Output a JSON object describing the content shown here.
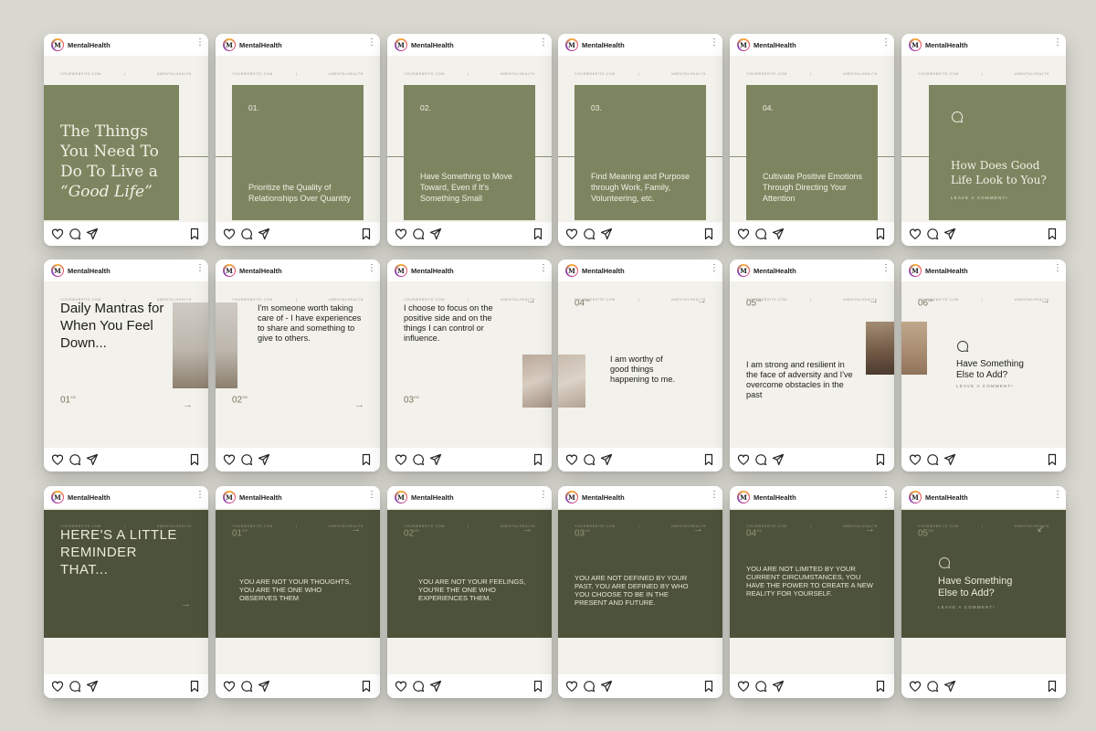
{
  "account": {
    "name": "MentalHealth",
    "avatar_letter": "M"
  },
  "meta": {
    "website": "YOURWEBSITE.COM",
    "hashtag": "#MENTALHEALTH",
    "divider": "|"
  },
  "icons": [
    "heart-icon",
    "comment-icon",
    "share-icon",
    "bookmark-icon",
    "more-icon",
    "arrow-right-icon",
    "chat-bubble-icon"
  ],
  "colors": {
    "olive": "#7d8560",
    "dark_olive": "#4d523a",
    "cream": "#f2f1eb"
  },
  "row1": {
    "cover": {
      "line1": "The Things",
      "line2": "You Need To",
      "line3": "Do To Live a",
      "line4": "“Good Life”"
    },
    "cards": [
      {
        "num": "01.",
        "text": "Prioritize the Quality of Relationships Over Quantity"
      },
      {
        "num": "02.",
        "text": "Have Something to Move Toward, Even if It's Something Small"
      },
      {
        "num": "03.",
        "text": "Find Meaning and Purpose through Work, Family, Volunteering, etc."
      },
      {
        "num": "04.",
        "text": "Cultivate Positive Emotions Through Directing Your Attention"
      }
    ],
    "final": {
      "line1": "How Does Good",
      "line2": "Life Look to You?",
      "cta": "LEAVE A COMMENT!"
    }
  },
  "row2": {
    "title": "Daily Mantras for When You Feel Down...",
    "num1": "01",
    "total": "/06",
    "m1": "I'm someone worth taking care of - I have experiences to share and something to give to others.",
    "num2": "02",
    "m2": "I choose to focus on the positive side and on the things I can control or influence.",
    "num3": "03",
    "num4": "04",
    "m3": "I am worthy of good things happening to me.",
    "num5": "05",
    "m4": "I am strong and resilient in the face of adversity and I've overcome obstacles in the past",
    "num6": "06",
    "final": "Have Something Else to Add?",
    "cta": "LEAVE A COMMENT!"
  },
  "row3": {
    "title": "HERE'S A LITTLE REMINDER THAT...",
    "total": "/05",
    "cards": [
      {
        "num": "01",
        "text": "YOU ARE NOT YOUR THOUGHTS, YOU ARE THE ONE WHO OBSERVES THEM"
      },
      {
        "num": "02",
        "text": "YOU ARE NOT YOUR FEELINGS, YOU'RE THE ONE WHO EXPERIENCES THEM."
      },
      {
        "num": "03",
        "text": "YOU ARE NOT DEFINED BY YOUR PAST. YOU ARE DEFINED BY WHO YOU CHOOSE TO BE IN THE PRESENT AND FUTURE."
      },
      {
        "num": "04",
        "text": "YOU ARE NOT LIMITED BY YOUR CURRENT CIRCUMSTANCES, YOU HAVE THE POWER TO CREATE A NEW REALITY FOR YOURSELF."
      }
    ],
    "num5": "05",
    "final": "Have Something Else to Add?",
    "cta": "LEAVE A COMMENT!"
  }
}
